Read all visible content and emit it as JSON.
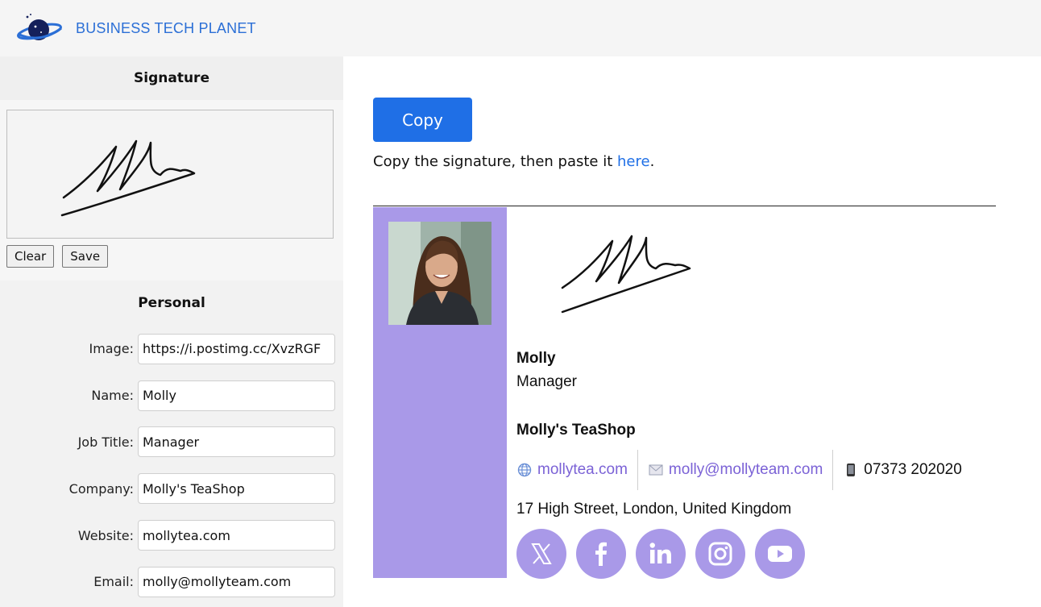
{
  "header": {
    "brand": "BUSINESS TECH PLANET",
    "logo_icon": "planet-logo-icon"
  },
  "left_panel": {
    "signature_section": {
      "title": "Signature",
      "clear_label": "Clear",
      "save_label": "Save"
    },
    "personal_section": {
      "title": "Personal",
      "fields": [
        {
          "label": "Image:",
          "value": "https://i.postimg.cc/XvzRGF"
        },
        {
          "label": "Name:",
          "value": "Molly"
        },
        {
          "label": "Job Title:",
          "value": "Manager"
        },
        {
          "label": "Company:",
          "value": "Molly's TeaShop"
        },
        {
          "label": "Website:",
          "value": "mollytea.com"
        },
        {
          "label": "Email:",
          "value": "molly@mollyteam.com"
        }
      ]
    }
  },
  "main": {
    "copy_label": "Copy",
    "instruction_text": "Copy the signature, then paste it ",
    "instruction_link": "here",
    "instruction_end": "."
  },
  "signature_preview": {
    "name": "Molly",
    "job_title": "Manager",
    "company": "Molly's TeaShop",
    "website": "mollytea.com",
    "email": "molly@mollyteam.com",
    "phone": "07373 202020",
    "address": "17 High Street, London, United Kingdom",
    "website_icon": "globe-icon",
    "email_icon": "envelope-icon",
    "phone_icon": "mobile-phone-icon",
    "socials": [
      "x-icon",
      "facebook-icon",
      "linkedin-icon",
      "instagram-icon",
      "youtube-icon"
    ]
  },
  "colors": {
    "accent_blue": "#1f6fe6",
    "brand_blue": "#2b6fd6",
    "signature_purple": "#a999e8",
    "link_purple": "#7b62d6"
  }
}
